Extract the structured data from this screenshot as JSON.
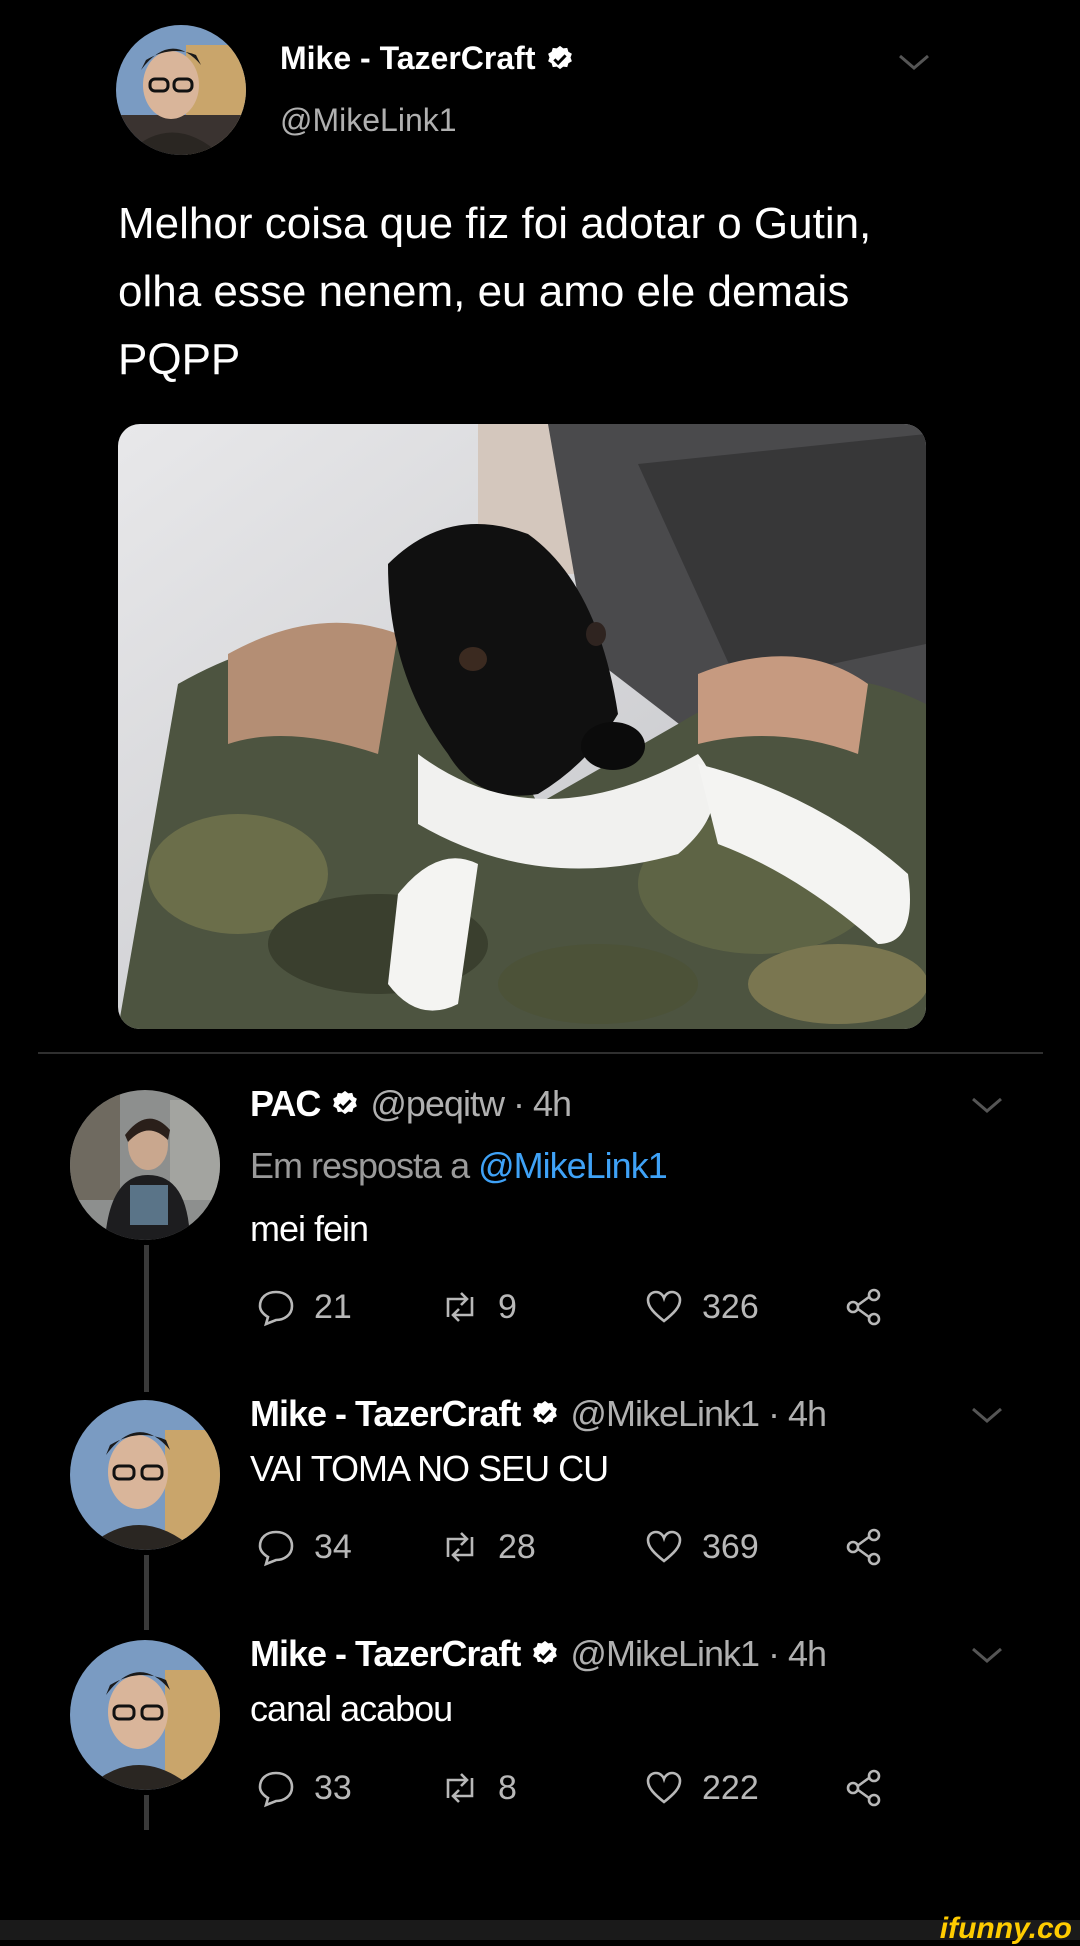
{
  "main_tweet": {
    "author_name": "Mike - TazerCraft",
    "author_handle": "@MikeLink1",
    "text": "Melhor coisa que fiz foi adotar o Gutin, olha esse nenem, eu amo ele demais PQPP"
  },
  "replies": [
    {
      "name": "PAC",
      "meta": "@peqitw · 4h",
      "reply_prefix": "Em resposta a ",
      "reply_to": "@MikeLink1",
      "text": "mei fein",
      "comments": "21",
      "retweets": "9",
      "likes": "326"
    },
    {
      "name": "Mike - TazerCraft",
      "meta": "@MikeLink1 · 4h",
      "text": "VAI TOMA NO SEU CU",
      "comments": "34",
      "retweets": "28",
      "likes": "369"
    },
    {
      "name": "Mike - TazerCraft",
      "meta": "@MikeLink1 · 4h",
      "text": "canal acabou",
      "comments": "33",
      "retweets": "8",
      "likes": "222"
    }
  ],
  "watermark": "ifunny.co",
  "colors": {
    "background": "#000000",
    "link": "#3fa2f7",
    "secondary_text": "#b0b0b0",
    "watermark": "#ffcc00"
  },
  "icons": [
    "verified-badge-icon",
    "chevron-down-icon",
    "comment-icon",
    "retweet-icon",
    "like-icon",
    "share-icon"
  ]
}
